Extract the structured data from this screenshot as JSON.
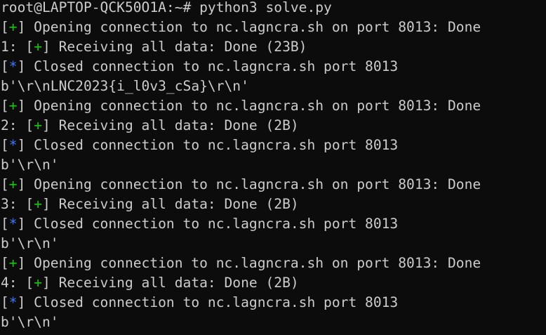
{
  "prompt": "root@LAPTOP-QCK50O1A:~# python3 solve.py",
  "colors": {
    "background": "#0c0c0c",
    "text": "#cccccc",
    "success_marker": "#16c60c",
    "info_marker": "#3b78ff"
  },
  "lines": [
    {
      "prefix": "",
      "marker": "+",
      "text": " Opening connection to nc.lagncra.sh on port 8013: Done"
    },
    {
      "prefix": "1: ",
      "marker": "+",
      "text": " Receiving all data: Done (23B)"
    },
    {
      "prefix": "",
      "marker": "*",
      "text": " Closed connection to nc.lagncra.sh port 8013"
    },
    {
      "prefix": "",
      "marker": "",
      "text": "b'\\r\\nLNC2023{i_l0v3_cSa}\\r\\n'"
    },
    {
      "prefix": "",
      "marker": "+",
      "text": " Opening connection to nc.lagncra.sh on port 8013: Done"
    },
    {
      "prefix": "2: ",
      "marker": "+",
      "text": " Receiving all data: Done (2B)"
    },
    {
      "prefix": "",
      "marker": "*",
      "text": " Closed connection to nc.lagncra.sh port 8013"
    },
    {
      "prefix": "",
      "marker": "",
      "text": "b'\\r\\n'"
    },
    {
      "prefix": "",
      "marker": "+",
      "text": " Opening connection to nc.lagncra.sh on port 8013: Done"
    },
    {
      "prefix": "3: ",
      "marker": "+",
      "text": " Receiving all data: Done (2B)"
    },
    {
      "prefix": "",
      "marker": "*",
      "text": " Closed connection to nc.lagncra.sh port 8013"
    },
    {
      "prefix": "",
      "marker": "",
      "text": "b'\\r\\n'"
    },
    {
      "prefix": "",
      "marker": "+",
      "text": " Opening connection to nc.lagncra.sh on port 8013: Done"
    },
    {
      "prefix": "4: ",
      "marker": "+",
      "text": " Receiving all data: Done (2B)"
    },
    {
      "prefix": "",
      "marker": "*",
      "text": " Closed connection to nc.lagncra.sh port 8013"
    },
    {
      "prefix": "",
      "marker": "",
      "text": "b'\\r\\n'"
    }
  ]
}
